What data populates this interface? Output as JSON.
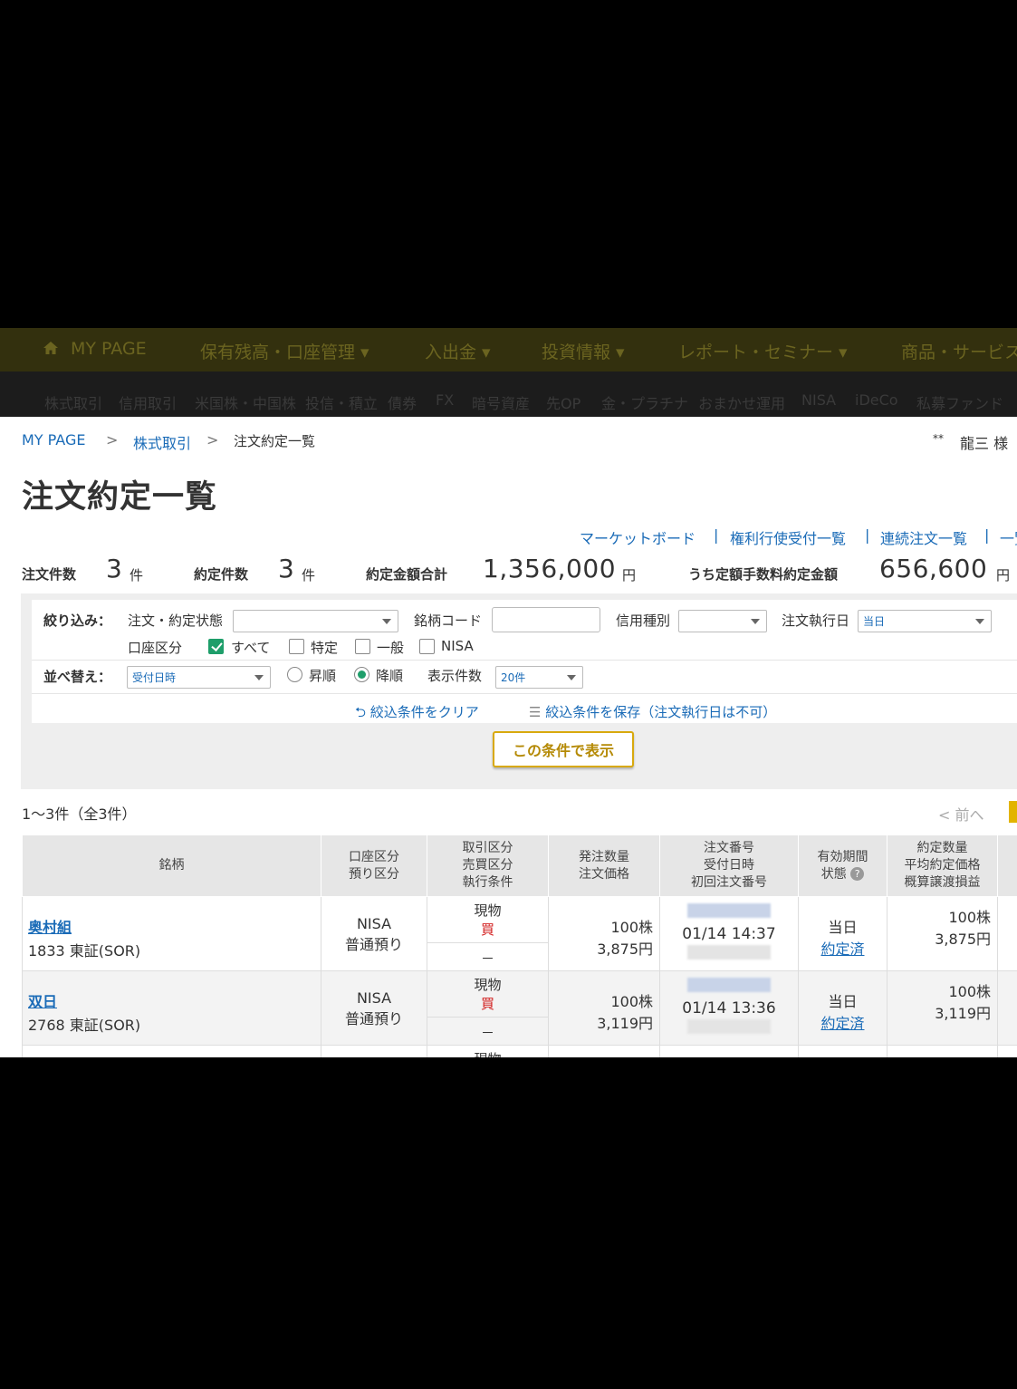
{
  "nav_primary": {
    "home": "MY PAGE",
    "items": [
      "保有残高・口座管理 ▾",
      "入出金 ▾",
      "投資情報 ▾",
      "レポート・セミナー ▾",
      "商品・サービス"
    ]
  },
  "nav_secondary": {
    "items": [
      "株式取引",
      "信用取引",
      "米国株・中国株",
      "投信・積立",
      "債券",
      "FX",
      "暗号資産",
      "先OP",
      "金・プラチナ",
      "おまかせ運用",
      "NISA",
      "iDeCo",
      "私募ファンド"
    ]
  },
  "breadcrumb": {
    "home": "MY PAGE",
    "parent": "株式取引",
    "current": "注文約定一覧",
    "sep": ">"
  },
  "user": {
    "mask": "**",
    "name": "龍三 様"
  },
  "page_title": "注文約定一覧",
  "sublinks": [
    "マーケットボード",
    "|",
    "権利行使受付一覧",
    "|",
    "連続注文一覧",
    "|",
    "一覧"
  ],
  "summary": {
    "order_count_label": "注文件数",
    "order_count": "3",
    "order_count_unit": "件",
    "exec_count_label": "約定件数",
    "exec_count": "3",
    "exec_count_unit": "件",
    "exec_total_label": "約定金額合計",
    "exec_total": "1,356,000",
    "exec_total_unit": "円",
    "fixed_fee_label": "うち定額手数料約定金額",
    "fixed_fee": "656,600",
    "fixed_fee_unit": "円"
  },
  "filter": {
    "label": "絞り込み：",
    "status_label": "注文・約定状態",
    "status_value": "",
    "code_label": "銘柄コード",
    "code_value": "",
    "credit_label": "信用種別",
    "credit_value": "",
    "exec_date_label": "注文執行日",
    "exec_date_value": "当日",
    "account_label": "口座区分",
    "account_options": [
      {
        "label": "すべて",
        "checked": true
      },
      {
        "label": "特定",
        "checked": false
      },
      {
        "label": "一般",
        "checked": false
      },
      {
        "label": "NISA",
        "checked": false
      }
    ],
    "sort_label": "並べ替え：",
    "sort_value": "受付日時",
    "asc_label": "昇順",
    "desc_label": "降順",
    "sort_order": "desc",
    "per_page_label": "表示件数",
    "per_page_value": "20件",
    "clear_label": "絞込条件をクリア",
    "save_label": "絞込条件を保存（注文執行日は不可）",
    "submit_label": "この条件で表示"
  },
  "results": {
    "count_text": "1〜3件（全3件）",
    "prev_label": "< 前へ"
  },
  "table": {
    "headers": [
      [
        "銘柄"
      ],
      [
        "口座区分",
        "預り区分"
      ],
      [
        "取引区分",
        "売買区分",
        "執行条件"
      ],
      [
        "発注数量",
        "注文価格"
      ],
      [
        "注文番号",
        "受付日時",
        "初回注文番号"
      ],
      [
        "有効期間",
        "状態"
      ],
      [
        "約定数量",
        "平均約定価格",
        "概算譲渡損益"
      ]
    ],
    "rows": [
      {
        "name": "奥村組",
        "code": "1833 東証(SOR)",
        "account": "NISA",
        "deposit": "普通預り",
        "trade_type": "現物",
        "side": "買",
        "condition": "－",
        "qty": "100株",
        "price": "3,875円",
        "received": "01/14 14:37",
        "validity": "当日",
        "status": "約定済",
        "exec_qty": "100株",
        "avg_price": "3,875円"
      },
      {
        "name": "双日",
        "code": "2768 東証(SOR)",
        "account": "NISA",
        "deposit": "普通預り",
        "trade_type": "現物",
        "side": "買",
        "condition": "－",
        "qty": "100株",
        "price": "3,119円",
        "received": "01/14 13:36",
        "validity": "当日",
        "status": "約定済",
        "exec_qty": "100株",
        "avg_price": "3,119円"
      },
      {
        "trade_type": "現物"
      }
    ]
  },
  "colors": {
    "link": "#1a6bb7",
    "accent": "#d8a90e",
    "buy": "#d21e1e",
    "check": "#1e9e6a"
  }
}
